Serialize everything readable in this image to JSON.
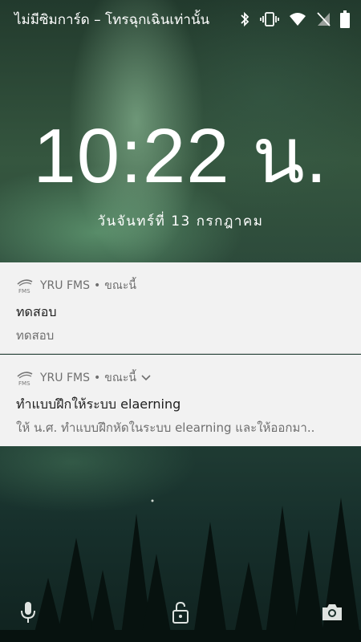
{
  "status_bar": {
    "carrier_text": "ไม่มีซิมการ์ด – โทรฉุกเฉินเท่านั้น",
    "icons": [
      "bluetooth-icon",
      "vibrate-icon",
      "wifi-icon",
      "no-sim-icon",
      "battery-icon"
    ]
  },
  "lockscreen": {
    "time": "10:22 น.",
    "date": "วันจันทร์ที่ 13 กรกฎาคม"
  },
  "notifications": [
    {
      "app": "YRU FMS",
      "time": "ขณะนี้",
      "title": "ทดสอบ",
      "body": "ทดสอบ"
    },
    {
      "app": "YRU FMS",
      "time": "ขณะนี้",
      "title": "ทำแบบฝึกให้ระบบ elaerning",
      "body": "ให้ น.ศ. ทำแบบฝึกหัดในระบบ elearning และให้ออกมา.."
    }
  ],
  "separator": "•",
  "bottom_actions": [
    "microphone-icon",
    "lock-icon",
    "camera-icon"
  ],
  "colors": {
    "notification_bg": "#f2f2f2",
    "text_primary": "#202020",
    "text_secondary": "#6f6f6f"
  }
}
